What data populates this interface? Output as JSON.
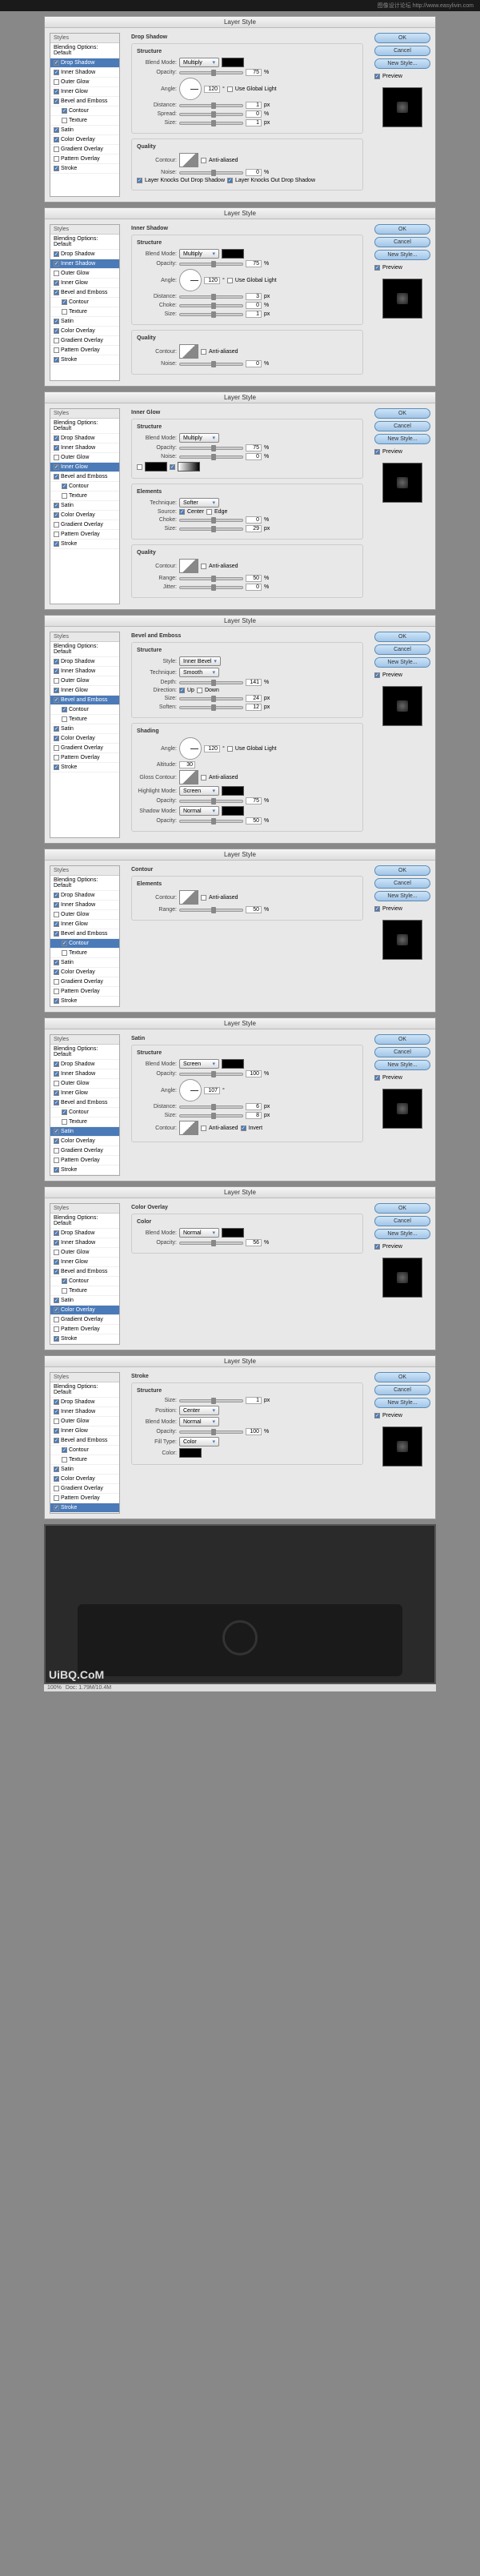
{
  "dialog_title": "Layer Style",
  "top_banner": "图像设计论坛 http://www.easylivin.com",
  "sidebar_header": "Styles",
  "buttons": {
    "ok": "OK",
    "cancel": "Cancel",
    "new": "New Style...",
    "preview": "Preview"
  },
  "styles": [
    {
      "label": "Blending Options: Default",
      "cb": null
    },
    {
      "label": "Drop Shadow",
      "cb": true
    },
    {
      "label": "Inner Shadow",
      "cb": true
    },
    {
      "label": "Outer Glow",
      "cb": false
    },
    {
      "label": "Inner Glow",
      "cb": true
    },
    {
      "label": "Bevel and Emboss",
      "cb": true
    },
    {
      "label": "Contour",
      "cb": true,
      "child": true
    },
    {
      "label": "Texture",
      "cb": false,
      "child": true
    },
    {
      "label": "Satin",
      "cb": true
    },
    {
      "label": "Color Overlay",
      "cb": true
    },
    {
      "label": "Gradient Overlay",
      "cb": false
    },
    {
      "label": "Pattern Overlay",
      "cb": false
    },
    {
      "label": "Stroke",
      "cb": true
    }
  ],
  "panels": [
    {
      "active": "Drop Shadow",
      "title": "Drop Shadow",
      "groups": [
        {
          "name": "Structure",
          "rows": [
            {
              "t": "sel",
              "label": "Blend Mode:",
              "val": "Multiply",
              "swatch": true
            },
            {
              "t": "slider",
              "label": "Opacity:",
              "val": "75",
              "unit": "%"
            },
            {
              "t": "angle",
              "label": "Angle:",
              "val": "120",
              "cb": "Use Global Light"
            },
            {
              "t": "slider",
              "label": "Distance:",
              "val": "1",
              "unit": "px"
            },
            {
              "t": "slider",
              "label": "Spread:",
              "val": "0",
              "unit": "%"
            },
            {
              "t": "slider",
              "label": "Size:",
              "val": "1",
              "unit": "px"
            }
          ]
        },
        {
          "name": "Quality",
          "rows": [
            {
              "t": "contour",
              "label": "Contour:",
              "cb": "Anti-aliased"
            },
            {
              "t": "slider",
              "label": "Noise:",
              "val": "0",
              "unit": "%"
            },
            {
              "t": "check",
              "cb": "Layer Knocks Out Drop Shadow",
              "on": true
            }
          ]
        }
      ]
    },
    {
      "active": "Inner Shadow",
      "title": "Inner Shadow",
      "groups": [
        {
          "name": "Structure",
          "rows": [
            {
              "t": "sel",
              "label": "Blend Mode:",
              "val": "Multiply",
              "swatch": true
            },
            {
              "t": "slider",
              "label": "Opacity:",
              "val": "75",
              "unit": "%"
            },
            {
              "t": "angle",
              "label": "Angle:",
              "val": "120",
              "cb": "Use Global Light"
            },
            {
              "t": "slider",
              "label": "Distance:",
              "val": "3",
              "unit": "px"
            },
            {
              "t": "slider",
              "label": "Choke:",
              "val": "0",
              "unit": "%"
            },
            {
              "t": "slider",
              "label": "Size:",
              "val": "1",
              "unit": "px"
            }
          ]
        },
        {
          "name": "Quality",
          "rows": [
            {
              "t": "contour",
              "label": "Contour:",
              "cb": "Anti-aliased"
            },
            {
              "t": "slider",
              "label": "Noise:",
              "val": "0",
              "unit": "%"
            }
          ]
        }
      ]
    },
    {
      "active": "Inner Glow",
      "title": "Inner Glow",
      "groups": [
        {
          "name": "Structure",
          "rows": [
            {
              "t": "sel",
              "label": "Blend Mode:",
              "val": "Multiply"
            },
            {
              "t": "slider",
              "label": "Opacity:",
              "val": "75",
              "unit": "%"
            },
            {
              "t": "slider",
              "label": "Noise:",
              "val": "0",
              "unit": "%"
            },
            {
              "t": "grad",
              "label": ""
            }
          ]
        },
        {
          "name": "Elements",
          "rows": [
            {
              "t": "sel",
              "label": "Technique:",
              "val": "Softer"
            },
            {
              "t": "radio",
              "label": "Source:",
              "opts": [
                "Center",
                "Edge"
              ]
            },
            {
              "t": "slider",
              "label": "Choke:",
              "val": "0",
              "unit": "%"
            },
            {
              "t": "slider",
              "label": "Size:",
              "val": "29",
              "unit": "px"
            }
          ]
        },
        {
          "name": "Quality",
          "rows": [
            {
              "t": "contour",
              "label": "Contour:",
              "cb": "Anti-aliased"
            },
            {
              "t": "slider",
              "label": "Range:",
              "val": "50",
              "unit": "%"
            },
            {
              "t": "slider",
              "label": "Jitter:",
              "val": "0",
              "unit": "%"
            }
          ]
        }
      ]
    },
    {
      "active": "Bevel and Emboss",
      "title": "Bevel and Emboss",
      "groups": [
        {
          "name": "Structure",
          "rows": [
            {
              "t": "sel",
              "label": "Style:",
              "val": "Inner Bevel"
            },
            {
              "t": "sel",
              "label": "Technique:",
              "val": "Smooth"
            },
            {
              "t": "slider",
              "label": "Depth:",
              "val": "141",
              "unit": "%"
            },
            {
              "t": "radio",
              "label": "Direction:",
              "opts": [
                "Up",
                "Down"
              ]
            },
            {
              "t": "slider",
              "label": "Size:",
              "val": "24",
              "unit": "px"
            },
            {
              "t": "slider",
              "label": "Soften:",
              "val": "12",
              "unit": "px"
            }
          ]
        },
        {
          "name": "Shading",
          "rows": [
            {
              "t": "angle",
              "label": "Angle:",
              "val": "120",
              "cb": "Use Global Light"
            },
            {
              "t": "plain",
              "label": "Altitude:",
              "val": "30"
            },
            {
              "t": "contour",
              "label": "Gloss Contour:",
              "cb": "Anti-aliased"
            },
            {
              "t": "sel",
              "label": "Highlight Mode:",
              "val": "Screen",
              "swatch": true
            },
            {
              "t": "slider",
              "label": "Opacity:",
              "val": "75",
              "unit": "%"
            },
            {
              "t": "sel",
              "label": "Shadow Mode:",
              "val": "Normal",
              "swatch": true
            },
            {
              "t": "slider",
              "label": "Opacity:",
              "val": "50",
              "unit": "%"
            }
          ]
        }
      ]
    },
    {
      "active": "Contour",
      "title": "Contour",
      "groups": [
        {
          "name": "Elements",
          "rows": [
            {
              "t": "contour",
              "label": "Contour:",
              "cb": "Anti-aliased"
            },
            {
              "t": "slider",
              "label": "Range:",
              "val": "50",
              "unit": "%"
            }
          ]
        }
      ]
    },
    {
      "active": "Satin",
      "title": "Satin",
      "groups": [
        {
          "name": "Structure",
          "rows": [
            {
              "t": "sel",
              "label": "Blend Mode:",
              "val": "Screen",
              "swatch": true
            },
            {
              "t": "slider",
              "label": "Opacity:",
              "val": "100",
              "unit": "%"
            },
            {
              "t": "angle",
              "label": "Angle:",
              "val": "107"
            },
            {
              "t": "slider",
              "label": "Distance:",
              "val": "6",
              "unit": "px"
            },
            {
              "t": "slider",
              "label": "Size:",
              "val": "8",
              "unit": "px"
            },
            {
              "t": "contour",
              "label": "Contour:",
              "cb": "Anti-aliased",
              "cb2": "Invert"
            }
          ]
        }
      ]
    },
    {
      "active": "Color Overlay",
      "title": "Color Overlay",
      "groups": [
        {
          "name": "Color",
          "rows": [
            {
              "t": "sel",
              "label": "Blend Mode:",
              "val": "Normal",
              "swatch": true
            },
            {
              "t": "slider",
              "label": "Opacity:",
              "val": "56",
              "unit": "%"
            }
          ]
        }
      ]
    },
    {
      "active": "Stroke",
      "title": "Stroke",
      "groups": [
        {
          "name": "Structure",
          "rows": [
            {
              "t": "slider",
              "label": "Size:",
              "val": "1",
              "unit": "px"
            },
            {
              "t": "sel",
              "label": "Position:",
              "val": "Center"
            },
            {
              "t": "sel",
              "label": "Blend Mode:",
              "val": "Normal"
            },
            {
              "t": "slider",
              "label": "Opacity:",
              "val": "100",
              "unit": "%"
            },
            {
              "t": "sel",
              "label": "Fill Type:",
              "val": "Color"
            },
            {
              "t": "color",
              "label": "Color:"
            }
          ]
        }
      ]
    }
  ],
  "statusbar": {
    "zoom": "100%",
    "doc": "Doc: 1.79M/10.4M"
  },
  "watermark": "UiBQ.CoM"
}
